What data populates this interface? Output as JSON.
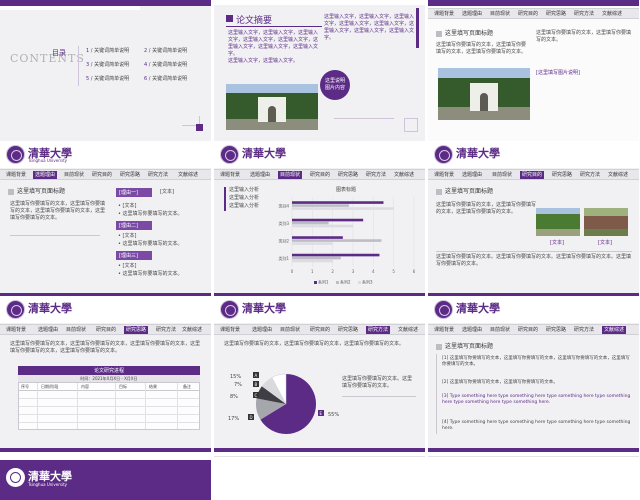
{
  "slide1": {
    "contents_title": "CONTENTS",
    "contents_label": "目录",
    "items": [
      {
        "num": "1",
        "label": "关键词简单说明"
      },
      {
        "num": "2",
        "label": "关键词简单说明"
      },
      {
        "num": "3",
        "label": "关键词简单说明"
      },
      {
        "num": "4",
        "label": "关键词简单说明"
      },
      {
        "num": "5",
        "label": "关键词简单说明"
      },
      {
        "num": "6",
        "label": "关键词简单说明"
      }
    ]
  },
  "slide2": {
    "title": "论文摘要",
    "body_left": "这里输入文字，这里输入文字，这里输入文字，这里输入文字，这里输入文字，这里输入文字，这里输入文字，这里输入文字。",
    "body_left2": "这里输入文字，这里输入文字。",
    "body_right": "这里输入文字，这里输入文字，这里输入文字，这里输入文字，这里输入文字，这里输入文字，这里输入文字，这里输入文字。",
    "bubble": "这里说明图片内容"
  },
  "slide3": {
    "nav": [
      "课题背景",
      "选题理由",
      "目前现状",
      "研究目的",
      "研究思路",
      "研究方法",
      "文献综述"
    ],
    "heading": "这里填写页面标题",
    "body_left": "这里填写你要填写的文本，这里填写你要填写的文本，这里填写你要填写的文本。",
    "body_right": "这里填写你要填写的文本，这里填写你要填写的文本。",
    "caption": "[这里填写图片说明]"
  },
  "slide4": {
    "logo": "清華大學",
    "logo_sub": "Tsinghua University",
    "nav": [
      "课题背景",
      "选题理由",
      "目前现状",
      "研究目的",
      "研究思路",
      "研究方法",
      "文献综述"
    ],
    "heading": "这里填写页面标题",
    "body": "这里填写你要填写的文本，这里填写你要填写的文本，这里填写你要填写的文本，这里填写你要填写的文本。",
    "reasons": [
      {
        "tag": "[理由一]",
        "text": "[文本]"
      },
      {
        "tag": "[理由二]",
        "text": "[文本]"
      },
      {
        "tag": "[理由三]",
        "text": "[文本]"
      }
    ],
    "bullet_text": "这里填写你要填写的文本。"
  },
  "slide5": {
    "logo": "清華大學",
    "nav": [
      "课题背景",
      "选题理由",
      "目前现状",
      "研究目的",
      "研究思路",
      "研究方法",
      "文献综述"
    ],
    "side_items": [
      "这里输入分析",
      "这里输入分析",
      "这里输入分析"
    ],
    "chart_title": "图表标题"
  },
  "slide6": {
    "logo": "清華大學",
    "nav": [
      "课题背景",
      "选题理由",
      "目前现状",
      "研究目的",
      "研究思路",
      "研究方法",
      "文献综述"
    ],
    "heading": "这里填写页面标题",
    "body": "这里填写你要填写的文本，这里填写你要填写的文本，这里填写你要填写的文本。",
    "captions": [
      "[文本]",
      "[文本]"
    ],
    "footer": "这里填写你要填写的文本。这里填写你要填写的文本。这里填写你要填写的文本。这里填写你要填写的文本。"
  },
  "slide7": {
    "logo": "清華大學",
    "nav": [
      "课题背景",
      "选题理由",
      "目前现状",
      "研究目的",
      "研究思路",
      "研究方法",
      "文献综述"
    ],
    "body": "这里填写你要填写的文本，这里填写你要填写的文本，这里填写你要填写的文本，这里填写你要填写的文本，这里填写你要填写的文本。",
    "table_title": "论文研究进程",
    "table_sub": "时间：2021年X月X日 - X月X日",
    "columns": [
      "序号",
      "日期/阶段",
      "内容",
      "目标",
      "结果",
      "备注"
    ]
  },
  "slide8": {
    "logo": "清華大學",
    "nav": [
      "课题背景",
      "选题理由",
      "目前现状",
      "研究目的",
      "研究思路",
      "研究方法",
      "文献综述"
    ],
    "body": "这里填写你要填写的文本，这里填写你要填写的文本，这里填写你要填写的文本。",
    "pie_text": "这里填写你要填写的文本。这里填写你要填写的文本。",
    "pie_labels": [
      "15%",
      "7%",
      "8%",
      "17%",
      "55%"
    ],
    "pie_letters": [
      "A",
      "B",
      "C",
      "D",
      "E"
    ]
  },
  "slide9": {
    "logo": "清華大學",
    "nav": [
      "课题背景",
      "选题理由",
      "目前现状",
      "研究目的",
      "研究思路",
      "研究方法",
      "文献综述"
    ],
    "heading": "这里填写页面标题",
    "p1": "[1] 这里填写你要填写的文本，这里填写你要填写的文本，这里填写你要填写的文本，这里填写你要填写的文本。",
    "p2": "[2] 这里填写你要填写的文本，这里填写你要填写的文本。",
    "p3": "[3] Type something here type something here type something here type something here type something here type something here.",
    "p4": "[4] Type something here type something here type something here type something here."
  },
  "slide10": {
    "logo": "清華大學",
    "logo_sub": "Tsinghua University"
  },
  "chart_data": [
    {
      "type": "bar",
      "title": "图表标题",
      "categories": [
        "类别1",
        "类别2",
        "类别3",
        "类别4"
      ],
      "series": [
        {
          "name": "系列1",
          "values": [
            4.3,
            2.5,
            3.5,
            4.5
          ]
        },
        {
          "name": "系列2",
          "values": [
            2.4,
            4.4,
            1.8,
            2.8
          ]
        },
        {
          "name": "系列3",
          "values": [
            2.0,
            2.0,
            3.0,
            5.0
          ]
        }
      ],
      "xlim": [
        0,
        6
      ],
      "colors": [
        "#5b2b86",
        "#bdbdc6",
        "#dcdce2"
      ]
    }
  ]
}
